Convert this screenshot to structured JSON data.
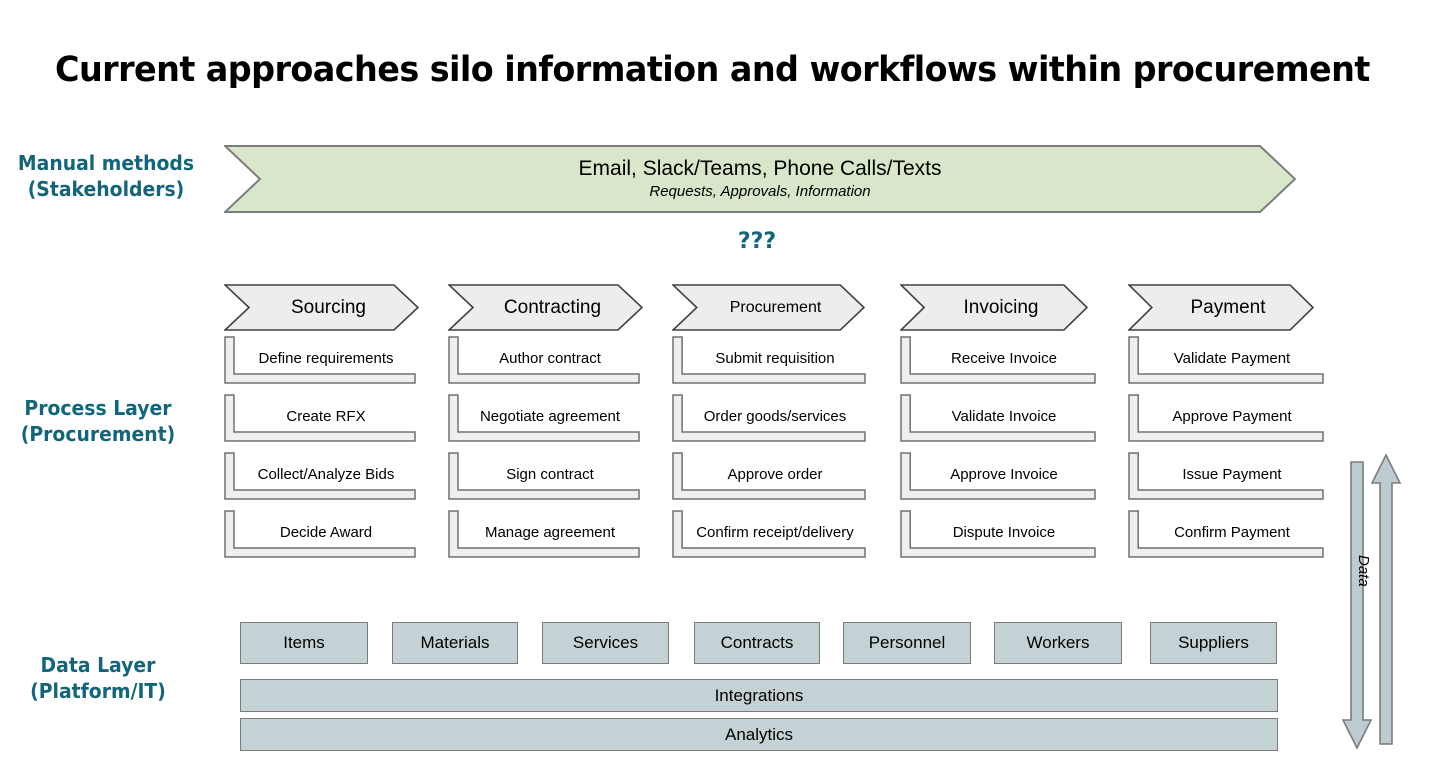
{
  "page_title": "Current approaches silo information and workflows within procurement",
  "colors": {
    "teal": "#12657A",
    "banner_fill": "#D8E7C9",
    "banner_stroke": "#7C7C7C",
    "process_fill": "#EDEDED",
    "process_stroke": "#404040",
    "data_fill": "#C5D2D5",
    "data_stroke": "#7B7B7B",
    "arrow_fill": "#BCCCD0"
  },
  "rows": {
    "manual": {
      "label": "Manual methods\n(Stakeholders)",
      "banner_main": "Email, Slack/Teams, Phone Calls/Texts",
      "banner_sub": "Requests, Approvals, Information"
    },
    "gap": {
      "question_marks": "???"
    },
    "process": {
      "label": "Process Layer\n(Procurement)",
      "columns": [
        {
          "header": "Sourcing",
          "items": [
            "Define requirements",
            "Create RFX",
            "Collect/Analyze Bids",
            "Decide Award"
          ]
        },
        {
          "header": "Contracting",
          "items": [
            "Author contract",
            "Negotiate agreement",
            "Sign contract",
            "Manage agreement"
          ]
        },
        {
          "header": "Procurement",
          "items": [
            "Submit requisition",
            "Order goods/services",
            "Approve order",
            "Confirm receipt/delivery"
          ]
        },
        {
          "header": "Invoicing",
          "items": [
            "Receive Invoice",
            "Validate Invoice",
            "Approve Invoice",
            "Dispute Invoice"
          ]
        },
        {
          "header": "Payment",
          "items": [
            "Validate Payment",
            "Approve Payment",
            "Issue Payment",
            "Confirm Payment"
          ]
        }
      ]
    },
    "data": {
      "label": "Data Layer\n(Platform/IT)",
      "entities": [
        "Items",
        "Materials",
        "Services",
        "Contracts",
        "Personnel",
        "Workers",
        "Suppliers"
      ],
      "bars": [
        "Integrations",
        "Analytics"
      ]
    },
    "side": {
      "arrow_label": "Data"
    }
  }
}
